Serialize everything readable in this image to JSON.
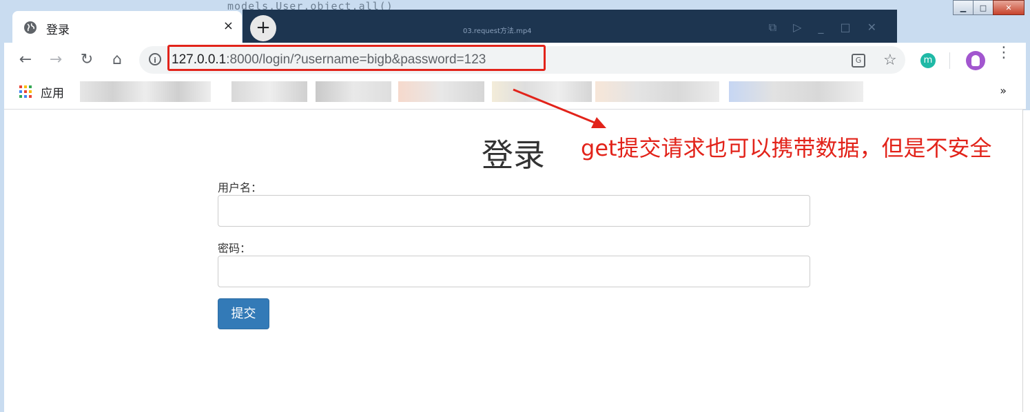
{
  "window": {
    "controls": {
      "minimize": "▁",
      "maximize": "□",
      "close": "✕"
    },
    "background_code": "models.User.object.all()",
    "background_video_title": "03.request方法.mp4"
  },
  "tab": {
    "title": "登录",
    "icon": "globe-icon",
    "close_label": "×",
    "new_tab_label": "+"
  },
  "toolbar": {
    "back_icon": "←",
    "forward_icon": "→",
    "reload_icon": "↻",
    "home_icon": "⌂",
    "url_host": "127.0.0.1",
    "url_rest": ":8000/login/?username=bigb&password=123",
    "extension_label": "m",
    "menu_icon": "⋮",
    "star_icon": "☆",
    "translate_label": "G"
  },
  "bookmarks": {
    "apps_label": "应用",
    "more_label": "»"
  },
  "page": {
    "heading": "登录",
    "username_label": "用户名：",
    "password_label": "密码：",
    "submit_label": "提交"
  },
  "annotation": {
    "text": "get提交请求也可以携带数据，但是不安全",
    "color": "#e2231a"
  },
  "colors": {
    "accent": "#337ab7",
    "annotation_red": "#e2231a"
  }
}
